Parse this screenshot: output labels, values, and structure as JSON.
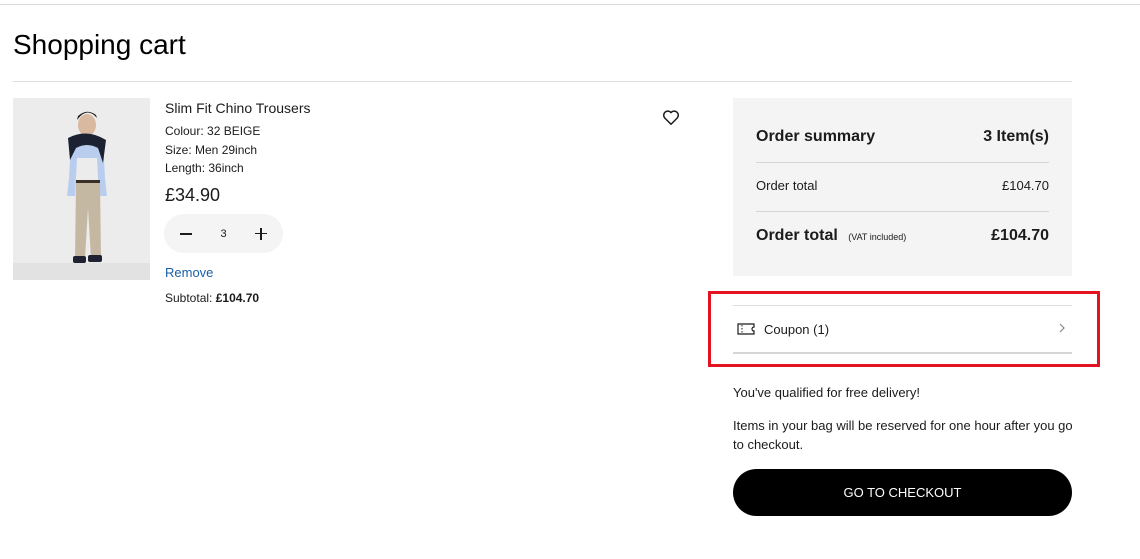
{
  "page": {
    "title": "Shopping cart"
  },
  "cart_item": {
    "image_alt": "Model wearing beige slim fit chino trousers",
    "name": "Slim Fit Chino Trousers",
    "colour": "Colour: 32 BEIGE",
    "size": "Size: Men 29inch",
    "length": "Length: 36inch",
    "price": "£34.90",
    "quantity": "3",
    "remove_label": "Remove",
    "subtotal_label": "Subtotal:",
    "subtotal_value": "£104.70",
    "favorite_icon": "heart-icon"
  },
  "summary": {
    "title": "Order summary",
    "item_count": "3 Item(s)",
    "order_total_label": "Order total",
    "order_total_value": "£104.70",
    "final_total_label": "Order total",
    "vat_note": "(VAT included)",
    "final_total_value": "£104.70"
  },
  "coupon": {
    "icon": "coupon-ticket-icon",
    "label": "Coupon (1)",
    "chevron": "chevron-right-icon"
  },
  "messages": {
    "delivery": "You've qualified for free delivery!",
    "reservation": "Items in your bag will be reserved for one hour after you go to checkout."
  },
  "checkout": {
    "label": "GO TO CHECKOUT"
  },
  "colors": {
    "highlight": "#e3141f",
    "link": "#1a5fa8",
    "summary_bg": "#f4f4f4",
    "checkout_bg": "#000000"
  }
}
